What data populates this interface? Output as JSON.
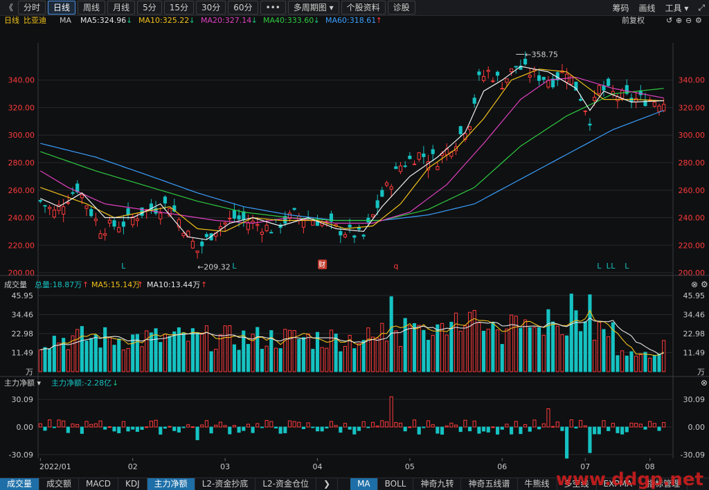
{
  "toolbar": {
    "back_glyph": "《",
    "buttons": [
      "分时",
      "日线",
      "周线",
      "月线",
      "5分",
      "15分",
      "30分",
      "60分",
      "•••",
      "多周期图 ▾",
      "个股资料",
      "诊股"
    ],
    "active_index": 1,
    "right": [
      "筹码",
      "画线",
      "工具 ▾",
      "⤢"
    ]
  },
  "main_header": {
    "period": "日线",
    "stock": "比亚迪",
    "ma": "MA",
    "items": [
      {
        "label": "MA5:324.96",
        "arrow": "↓",
        "color": "#e6e6e6",
        "arrow_color": "#19c37d"
      },
      {
        "label": "MA10:325.22",
        "arrow": "↓",
        "color": "#f2c21a",
        "arrow_color": "#19c37d"
      },
      {
        "label": "MA20:327.14",
        "arrow": "↓",
        "color": "#e040c0",
        "arrow_color": "#19c37d"
      },
      {
        "label": "MA40:333.60",
        "arrow": "↓",
        "color": "#2ecc40",
        "arrow_color": "#19c37d"
      },
      {
        "label": "MA60:318.61",
        "arrow": "↑",
        "color": "#3aa0ff",
        "arrow_color": "#ff3b3b"
      }
    ],
    "right_label": "前复权"
  },
  "vol_header": {
    "name": "成交量",
    "total": "总量:18.87万",
    "total_arrow": "↑",
    "ma5": "MA5:15.14万",
    "ma5_arrow": "↑",
    "ma10": "MA10:13.44万",
    "ma10_arrow": "↑"
  },
  "flow_header": {
    "name": "主力净额",
    "value": "主力净额:-2.28亿",
    "arrow": "↓"
  },
  "bottom_tabs": [
    {
      "label": "成交量",
      "active": true
    },
    {
      "label": "成交额"
    },
    {
      "label": "MACD"
    },
    {
      "label": "KDJ"
    },
    {
      "label": "主力净额",
      "active": true
    },
    {
      "label": "L2-资金抄底"
    },
    {
      "label": "L2-资金仓位"
    },
    {
      "label": "❯"
    },
    {
      "label": "MA",
      "active": true
    },
    {
      "label": "BOLL"
    },
    {
      "label": "神奇九转"
    },
    {
      "label": "神奇五线谱"
    },
    {
      "label": "牛熊线"
    },
    {
      "label": "多空线"
    },
    {
      "label": "EXPMA"
    },
    {
      "label": "指标管理"
    }
  ],
  "watermark": "www.ddgp.net",
  "colors": {
    "up": "#ff3b3b",
    "down": "#16c2c2",
    "grid": "#26282c",
    "axis_text_red": "#ff3b3b",
    "axis_text": "#c9c9c9"
  },
  "chart_data": {
    "type": "candlestick",
    "price_axis": {
      "ticks": [
        "340.00",
        "320.00",
        "300.00",
        "280.00",
        "260.00",
        "240.00",
        "220.00",
        "200.00"
      ],
      "ylim": [
        198,
        362
      ]
    },
    "x_labels": [
      "2022/01",
      "02",
      "03",
      "04",
      "05",
      "06",
      "07",
      "08"
    ],
    "annotations": {
      "high": "358.75",
      "low": "209.32"
    },
    "markers": [
      "L",
      "L",
      "财",
      "q",
      "L",
      "L",
      "L",
      "L"
    ],
    "anchors": [
      [
        0,
        252
      ],
      [
        3,
        244
      ],
      [
        8,
        262
      ],
      [
        13,
        232
      ],
      [
        18,
        236
      ],
      [
        22,
        244
      ],
      [
        28,
        250
      ],
      [
        34,
        216
      ],
      [
        38,
        232
      ],
      [
        42,
        240
      ],
      [
        46,
        236
      ],
      [
        50,
        232
      ],
      [
        55,
        242
      ],
      [
        60,
        238
      ],
      [
        64,
        232
      ],
      [
        68,
        228
      ],
      [
        70,
        226
      ],
      [
        74,
        256
      ],
      [
        78,
        278
      ],
      [
        82,
        286
      ],
      [
        86,
        282
      ],
      [
        90,
        296
      ],
      [
        93,
        310
      ],
      [
        95,
        340
      ],
      [
        97,
        346
      ],
      [
        100,
        338
      ],
      [
        103,
        350
      ],
      [
        107,
        344
      ],
      [
        111,
        340
      ],
      [
        114,
        348
      ],
      [
        117,
        328
      ],
      [
        119,
        312
      ],
      [
        121,
        334
      ],
      [
        124,
        330
      ],
      [
        128,
        326
      ],
      [
        132,
        326
      ],
      [
        135,
        324
      ]
    ],
    "ma_series": [
      {
        "name": "MA60",
        "color": "#3aa0ff",
        "anchors": [
          [
            0,
            294
          ],
          [
            12,
            284
          ],
          [
            24,
            270
          ],
          [
            34,
            258
          ],
          [
            44,
            248
          ],
          [
            54,
            242
          ],
          [
            64,
            238
          ],
          [
            74,
            238
          ],
          [
            84,
            242
          ],
          [
            94,
            250
          ],
          [
            104,
            268
          ],
          [
            114,
            286
          ],
          [
            124,
            304
          ],
          [
            135,
            318
          ]
        ]
      },
      {
        "name": "MA40",
        "color": "#2ecc40",
        "anchors": [
          [
            0,
            288
          ],
          [
            12,
            274
          ],
          [
            24,
            262
          ],
          [
            34,
            252
          ],
          [
            44,
            244
          ],
          [
            54,
            240
          ],
          [
            64,
            238
          ],
          [
            74,
            238
          ],
          [
            84,
            246
          ],
          [
            94,
            262
          ],
          [
            104,
            292
          ],
          [
            114,
            314
          ],
          [
            124,
            330
          ],
          [
            135,
            334
          ]
        ]
      },
      {
        "name": "MA20",
        "color": "#e040c0",
        "anchors": [
          [
            0,
            274
          ],
          [
            6,
            262
          ],
          [
            14,
            250
          ],
          [
            22,
            246
          ],
          [
            30,
            242
          ],
          [
            38,
            238
          ],
          [
            46,
            236
          ],
          [
            54,
            240
          ],
          [
            64,
            236
          ],
          [
            72,
            236
          ],
          [
            80,
            244
          ],
          [
            88,
            264
          ],
          [
            96,
            294
          ],
          [
            104,
            326
          ],
          [
            110,
            340
          ],
          [
            116,
            342
          ],
          [
            124,
            334
          ],
          [
            135,
            327
          ]
        ]
      },
      {
        "name": "MA10",
        "color": "#f2c21a",
        "anchors": [
          [
            0,
            262
          ],
          [
            5,
            256
          ],
          [
            10,
            250
          ],
          [
            16,
            240
          ],
          [
            22,
            244
          ],
          [
            28,
            248
          ],
          [
            34,
            232
          ],
          [
            40,
            230
          ],
          [
            46,
            240
          ],
          [
            52,
            238
          ],
          [
            60,
            238
          ],
          [
            66,
            232
          ],
          [
            72,
            234
          ],
          [
            78,
            250
          ],
          [
            84,
            276
          ],
          [
            90,
            290
          ],
          [
            96,
            312
          ],
          [
            102,
            340
          ],
          [
            108,
            348
          ],
          [
            114,
            346
          ],
          [
            118,
            336
          ],
          [
            122,
            326
          ],
          [
            128,
            326
          ],
          [
            135,
            325
          ]
        ]
      },
      {
        "name": "MA5",
        "color": "#f0f0f0",
        "anchors": [
          [
            0,
            254
          ],
          [
            4,
            248
          ],
          [
            9,
            258
          ],
          [
            14,
            240
          ],
          [
            20,
            240
          ],
          [
            26,
            250
          ],
          [
            32,
            226
          ],
          [
            36,
            224
          ],
          [
            41,
            236
          ],
          [
            46,
            240
          ],
          [
            52,
            234
          ],
          [
            58,
            240
          ],
          [
            64,
            232
          ],
          [
            70,
            230
          ],
          [
            74,
            248
          ],
          [
            80,
            270
          ],
          [
            86,
            284
          ],
          [
            92,
            302
          ],
          [
            96,
            332
          ],
          [
            100,
            340
          ],
          [
            104,
            350
          ],
          [
            110,
            346
          ],
          [
            116,
            334
          ],
          [
            119,
            318
          ],
          [
            122,
            332
          ],
          [
            128,
            324
          ],
          [
            135,
            325
          ]
        ]
      }
    ],
    "volume_axis": {
      "ticks": [
        "45.95",
        "34.46",
        "22.98",
        "11.49",
        "万"
      ],
      "max": 48
    },
    "flow_axis": {
      "ticks": [
        "30.09",
        "0.00",
        "-30.09"
      ],
      "range": [
        -34,
        34
      ]
    },
    "n_bars": 136
  }
}
